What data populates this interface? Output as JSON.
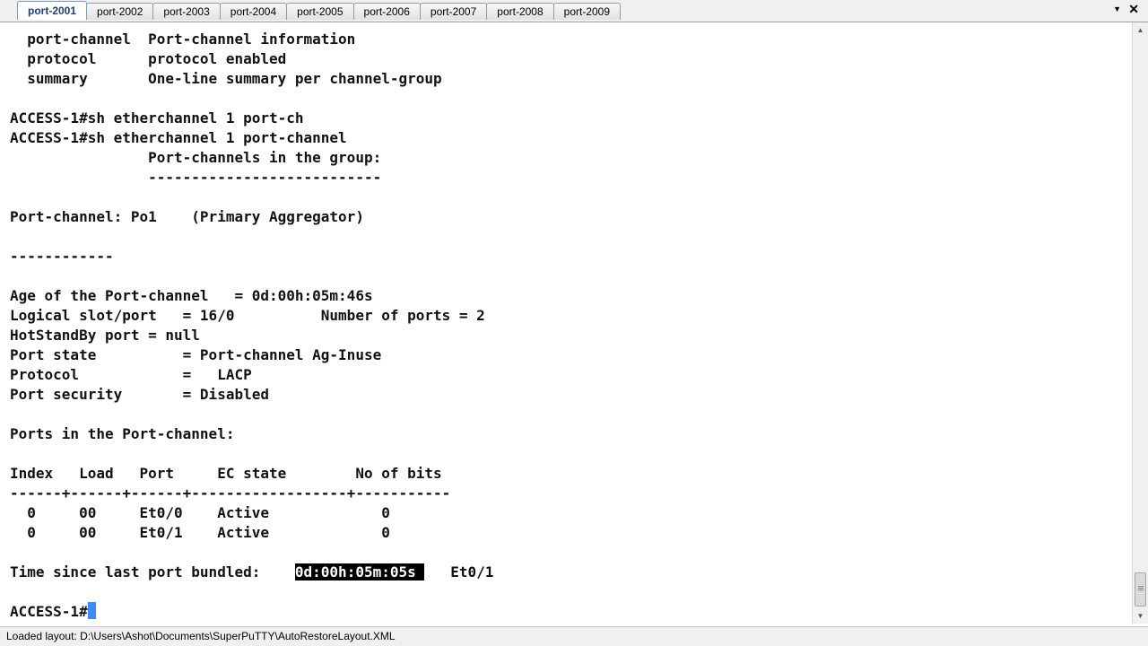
{
  "tabs": [
    "port-2001",
    "port-2002",
    "port-2003",
    "port-2004",
    "port-2005",
    "port-2006",
    "port-2007",
    "port-2008",
    "port-2009"
  ],
  "active_tab": "port-2001",
  "icons": {
    "tab_list": "chevron-down-icon",
    "close": "close-icon"
  },
  "terminal": {
    "lines": [
      "  port-channel  Port-channel information",
      "  protocol      protocol enabled",
      "  summary       One-line summary per channel-group",
      "",
      "ACCESS-1#sh etherchannel 1 port-ch",
      "ACCESS-1#sh etherchannel 1 port-channel",
      "                Port-channels in the group:",
      "                ---------------------------",
      "",
      "Port-channel: Po1    (Primary Aggregator)",
      "",
      "------------",
      "",
      "Age of the Port-channel   = 0d:00h:05m:46s",
      "Logical slot/port   = 16/0          Number of ports = 2",
      "HotStandBy port = null",
      "Port state          = Port-channel Ag-Inuse",
      "Protocol            =   LACP",
      "Port security       = Disabled",
      "",
      "Ports in the Port-channel:",
      "",
      "Index   Load   Port     EC state        No of bits",
      "------+------+------+------------------+-----------",
      "  0     00     Et0/0    Active             0",
      "  0     00     Et0/1    Active             0",
      "",
      "Time since last port bundled:    0d:00h:05m:05s    Et0/1",
      ""
    ],
    "bundled_prefix": "Time since last port bundled:    ",
    "bundled_time": "0d:00h:05m:05s ",
    "bundled_suffix": "   Et0/1",
    "prompt": "ACCESS-1#"
  },
  "status_bar": {
    "text": "Loaded layout: D:\\Users\\Ashot\\Documents\\SuperPuTTY\\AutoRestoreLayout.XML"
  },
  "colors": {
    "terminal_bg": "#ffffff",
    "terminal_fg": "#111111",
    "cursor": "#3c8cff",
    "selection_bg": "#000000"
  }
}
